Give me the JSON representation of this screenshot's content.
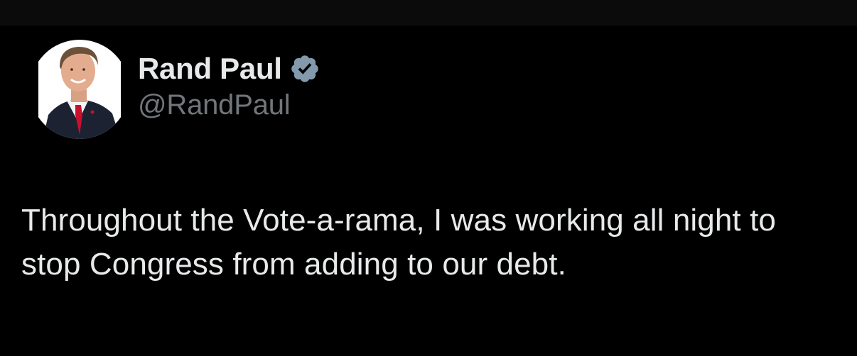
{
  "tweet": {
    "author": {
      "display_name": "Rand Paul",
      "handle": "@RandPaul",
      "verified": true,
      "verified_icon": "verified-badge-icon",
      "avatar_icon": "profile-photo"
    },
    "text": "Throughout the Vote-a-rama, I was working all night to stop Congress from adding to our debt."
  },
  "colors": {
    "background": "#000000",
    "text_primary": "#e7e9ea",
    "text_secondary": "#71767b",
    "badge": "#829aab"
  }
}
